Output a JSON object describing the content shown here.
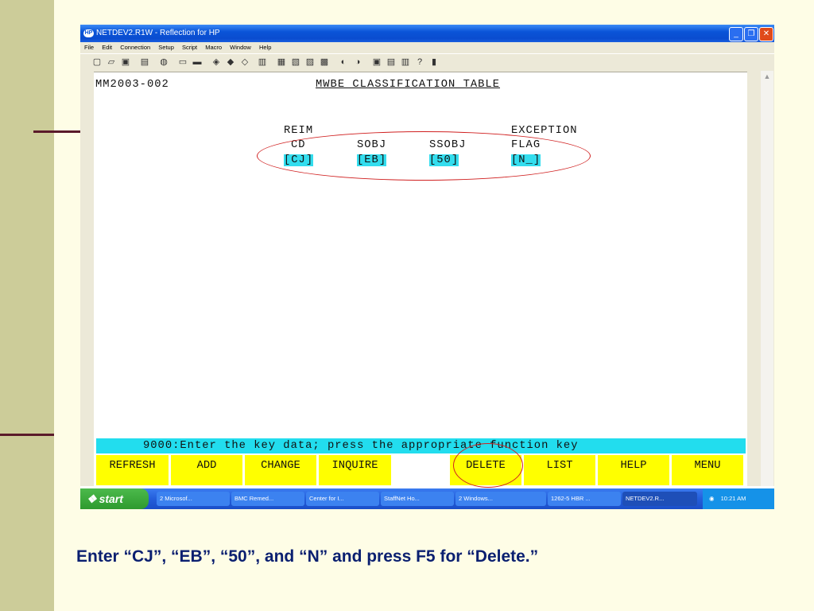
{
  "window": {
    "title": "NETDEV2.R1W - Reflection for HP",
    "hp_badge": "HP",
    "minimize": "_",
    "maximize": "❐",
    "close": "✕"
  },
  "menu": [
    "File",
    "Edit",
    "Connection",
    "Setup",
    "Script",
    "Macro",
    "Window",
    "Help"
  ],
  "toolbar_icons": [
    "new-icon",
    "open-icon",
    "save-icon",
    "print-icon",
    "find-icon",
    "copy-icon",
    "paste-icon",
    "connect-icon",
    "disconnect-icon",
    "setup-icon",
    "keyboard-icon",
    "display-icon",
    "terminal-icon",
    "transfer-icon",
    "macro-icon",
    "record-icon",
    "send-icon",
    "receive-icon",
    "settings-icon",
    "help-icon",
    "book-icon"
  ],
  "terminal": {
    "screen_id": "MM2003-002",
    "screen_title": "MWBE CLASSIFICATION TABLE",
    "headers": {
      "reim": "REIM",
      "cd": "CD",
      "sobj": "SOBJ",
      "ssobj": "SSOBJ",
      "exception": "EXCEPTION",
      "flag": "FLAG"
    },
    "fields": {
      "reim_cd": "[CJ]",
      "sobj": "[EB]",
      "ssobj": "[50]",
      "flag": "[N_]"
    },
    "status_message": "9000:Enter the key data; press the appropriate function key",
    "function_keys": [
      "REFRESH",
      "ADD",
      "CHANGE",
      "INQUIRE",
      "",
      "DELETE",
      "LIST",
      "HELP",
      "MENU"
    ]
  },
  "taskbar": {
    "start": "start",
    "tasks": [
      "2 Microsof...",
      "BMC Remed...",
      "Center for I...",
      "StaffNet Ho...",
      "2 Windows...",
      "1262-5 HBR ...",
      "NETDEV2.R..."
    ],
    "clock": "10:21 AM"
  },
  "colors": {
    "highlight_field": "#33ddee",
    "function_key": "#ffff00",
    "annotation_oval": "#d02020",
    "caption": "#0a1f70",
    "slide_bg": "#fefde6",
    "slide_bar": "#cccc99"
  },
  "caption": "Enter “CJ”, “EB”, “50”, and “N” and press F5 for “Delete.”"
}
